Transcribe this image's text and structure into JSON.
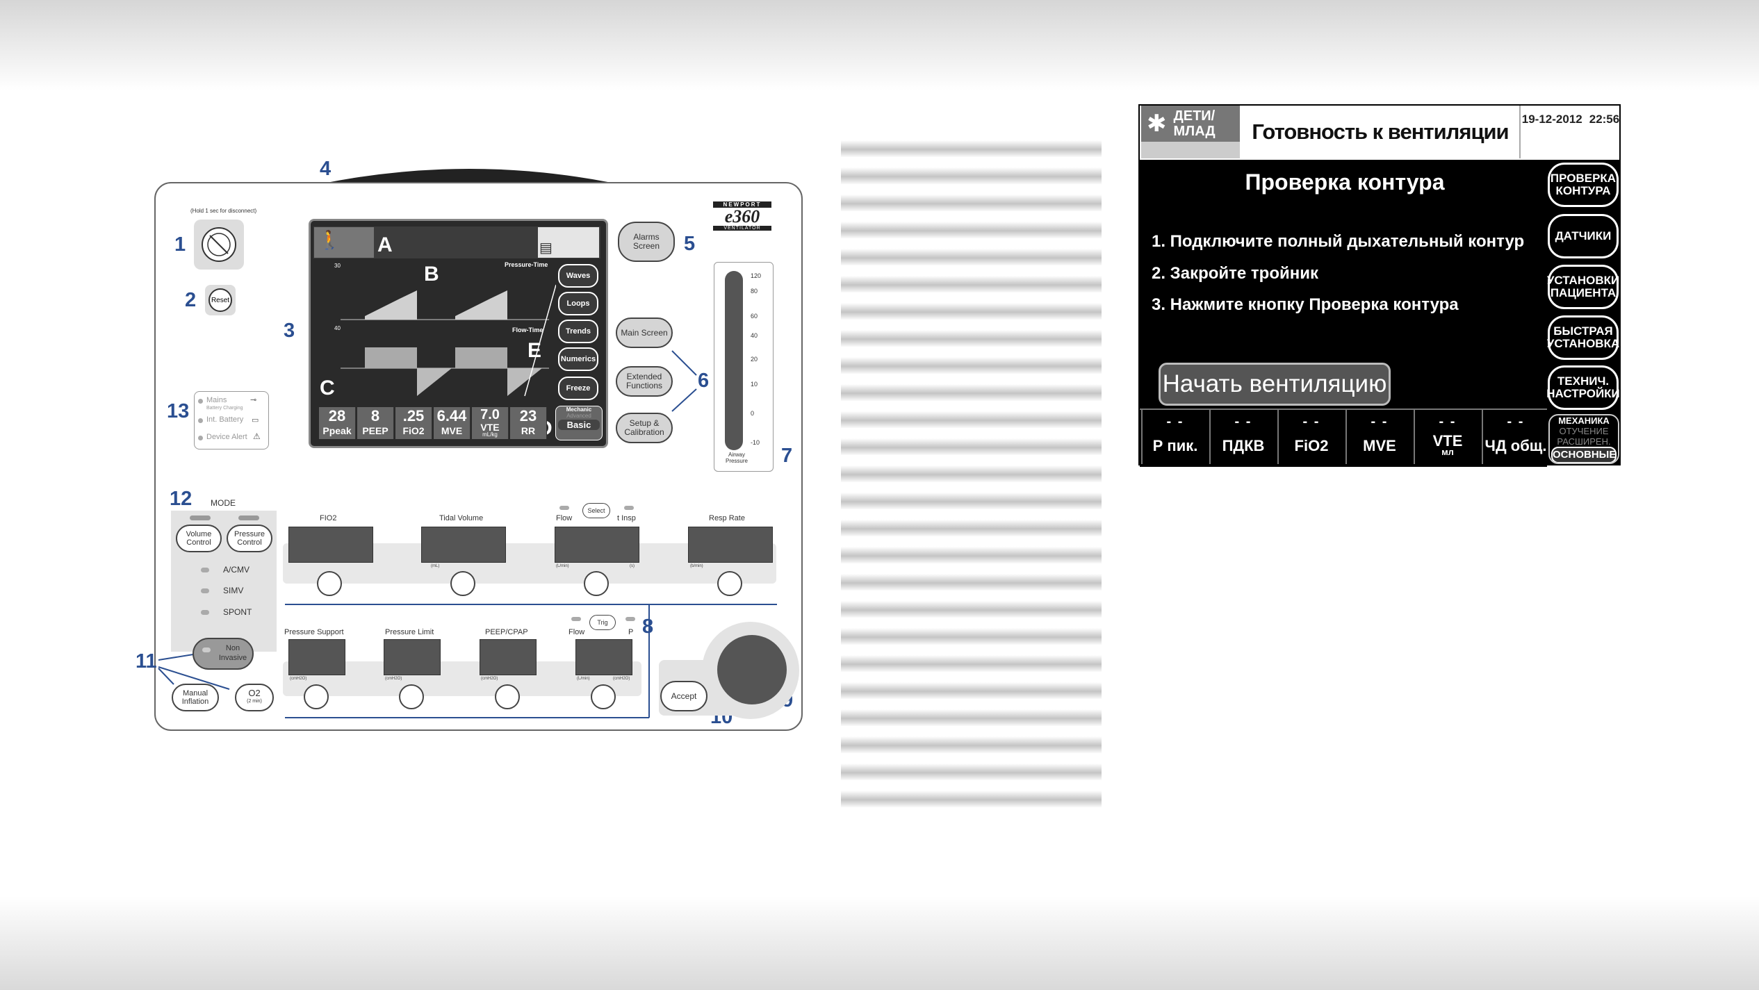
{
  "callouts": [
    "1",
    "2",
    "3",
    "4",
    "5",
    "6",
    "7",
    "8",
    "9",
    "10",
    "11",
    "12",
    "13",
    "A",
    "B",
    "C",
    "D",
    "E"
  ],
  "brand": {
    "maker": "NEWPORT",
    "model": "e360",
    "sub": "VENTILATOR"
  },
  "front_panel": {
    "hold_note": "(Hold 1 sec for disconnect)",
    "reset_label": "Reset",
    "alarms_screen": "Alarms Screen",
    "main_screen": "Main Screen",
    "extended_functions": "Extended Functions",
    "setup_calibration": "Setup & Calibration",
    "airway_scale": [
      "120",
      "80",
      "60",
      "40",
      "20",
      "10",
      "0",
      "-10"
    ],
    "airway_label": "Airway Pressure",
    "status": {
      "mains": "Mains",
      "battery_charging": "Battery Charging",
      "int_battery": "Int. Battery",
      "device_alert": "Device Alert"
    },
    "mode_title": "MODE",
    "volume_control": "Volume Control",
    "pressure_control": "Pressure Control",
    "modes": [
      "A/CMV",
      "SIMV",
      "SPONT"
    ],
    "non_invasive": "Non Invasive",
    "manual_inflation": "Manual Inflation",
    "o2": "O2",
    "o2_sub": "(2 min)",
    "accept": "Accept",
    "row1": {
      "fio2": "FIO2",
      "tidal_volume": "Tidal Volume",
      "flow": "Flow",
      "select": "Select",
      "t_insp": "t Insp",
      "resp_rate": "Resp Rate"
    },
    "row1_units": [
      "(mL)",
      "(L/min)",
      "(s)",
      "(b/min)"
    ],
    "row2": {
      "pressure_support": "Pressure Support",
      "pressure_limit": "Pressure Limit",
      "peep_cpap": "PEEP/CPAP",
      "flow": "Flow",
      "trig": "Trig",
      "p": "P"
    },
    "row2_units": [
      "(cmH2O)",
      "(cmH2O)",
      "(cmH2O)",
      "(L/min)",
      "(cmH2O)"
    ]
  },
  "screen": {
    "waves_top": "Pressure-Time",
    "waves_bottom": "Flow-Time",
    "axis_top": "30",
    "axis_bottom": "40",
    "buttons": [
      "Waves",
      "Loops",
      "Trends",
      "Numerics",
      "Freeze"
    ],
    "numerics": [
      {
        "value": "28",
        "label": "Ppeak"
      },
      {
        "value": "8",
        "label": "PEEP"
      },
      {
        "value": ".25",
        "label": "FiO2"
      },
      {
        "value": "6.44",
        "label": "MVE"
      },
      {
        "value": "7.0",
        "label": "VTE",
        "sub": "mL/kg"
      },
      {
        "value": "23",
        "label": "RR"
      }
    ],
    "levels": [
      "Mechanic",
      "Advanced",
      "Basic"
    ]
  },
  "lcd": {
    "patient": "ДЕТИ/ МЛАД",
    "title": "Готовность к вентиляции",
    "date": "19-12-2012",
    "time": "22:56",
    "heading": "Проверка контура",
    "steps": [
      "1. Подключите полный дыхательный контур",
      "2. Закройте тройник",
      "3. Нажмите кнопку Проверка контура"
    ],
    "start_button": "Начать вентиляцию",
    "side_buttons": [
      "ПРОВЕРКА КОНТУРА",
      "ДАТЧИКИ",
      "УСТАНОВКИ ПАЦИЕНТА",
      "БЫСТРАЯ УСТАНОВКА",
      "ТЕХНИЧ. НАСТРОЙКИ"
    ],
    "numerics": [
      {
        "value": "- -",
        "label": "Р пик."
      },
      {
        "value": "- -",
        "label": "ПДКВ"
      },
      {
        "value": "- -",
        "label": "FiO2"
      },
      {
        "value": "- -",
        "label": "MVE"
      },
      {
        "value": "- -",
        "label": "VTE",
        "sub": "мл"
      },
      {
        "value": "- -",
        "label": "ЧД общ."
      }
    ],
    "levels": [
      "МЕХАНИКА",
      "ОТУЧЕНИЕ",
      "РАСШИРЕН.",
      "ОСНОВНЫЕ"
    ]
  }
}
